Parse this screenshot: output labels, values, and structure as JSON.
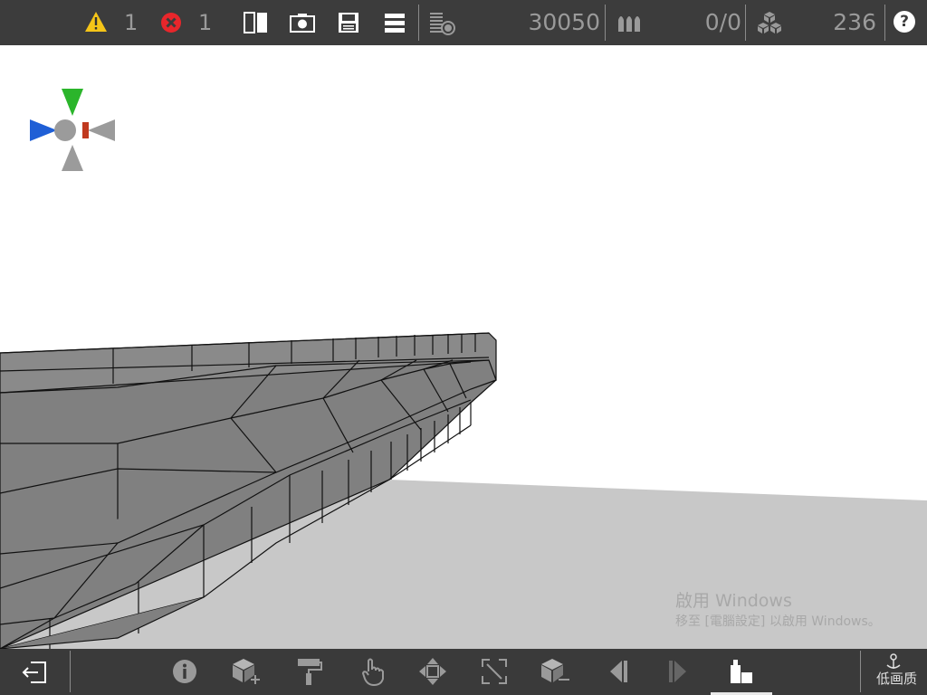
{
  "topbar": {
    "warnings": {
      "icon": "warning-icon",
      "count": "1",
      "color": "#f5c518"
    },
    "errors": {
      "icon": "error-icon",
      "count": "1",
      "color": "#e8262b"
    },
    "tools": [
      "split-view-icon",
      "camera-icon",
      "save-icon",
      "menu-icon",
      "layers-render-icon"
    ],
    "polygon_count": "30050",
    "ammo_icon": "ammo-icon",
    "ammo_value": "0/0",
    "blocks_icon": "blocks-icon",
    "block_count": "236",
    "help_label": "?"
  },
  "viewport": {
    "colors": {
      "hull": "#808080",
      "floor": "#c8c8c8",
      "sky": "#ffffff"
    },
    "gizmo": {
      "colors": {
        "y": "#2bb52b",
        "x": "#c0391f",
        "z": "#1f5fd6",
        "neutral": "#9b9b9b"
      }
    }
  },
  "watermark": {
    "line1": "啟用 Windows",
    "line2": "移至 [電腦設定] 以啟用 Windows。"
  },
  "bottombar": {
    "exit_icon": "exit-icon",
    "tools": [
      "info-icon",
      "add-block-icon",
      "paint-roller-icon",
      "hand-pointer-icon",
      "move-arrows-icon",
      "resize-icon",
      "remove-block-icon",
      "previous-icon",
      "next-icon",
      "build-mode-icon"
    ],
    "active_tool": "build-mode-icon",
    "quality_label": "低画质"
  }
}
